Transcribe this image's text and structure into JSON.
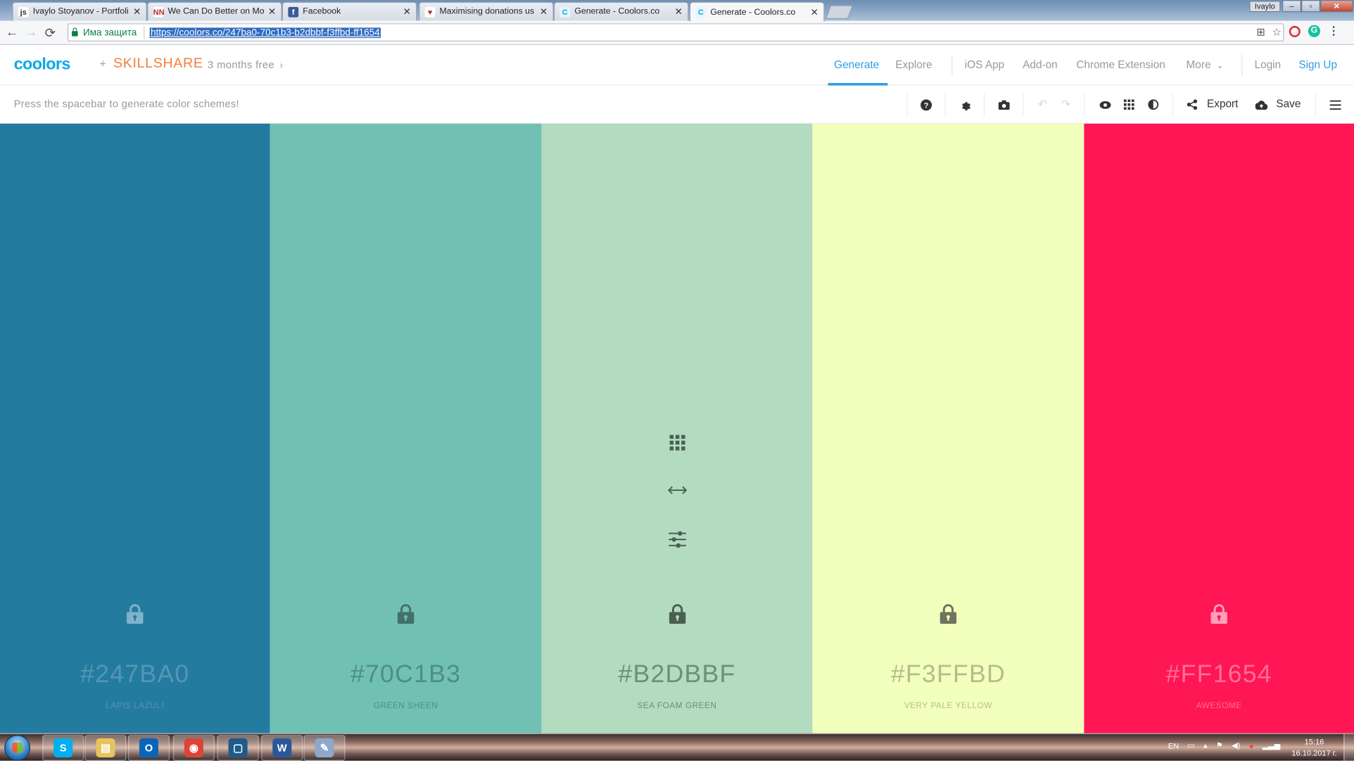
{
  "browser": {
    "tabs": [
      {
        "title": "Ivaylo Stoyanov - Portfoli",
        "favicon": "js-icon",
        "fav_text": "js",
        "fav_color": "#ffffff",
        "fav_text_color": "#333333"
      },
      {
        "title": "We Can Do Better on Mo",
        "favicon": "nn-icon",
        "fav_text": "NN",
        "fav_color": "#ffffff",
        "fav_text_color": "#c62828"
      },
      {
        "title": "Facebook",
        "favicon": "facebook-icon",
        "fav_text": "f",
        "fav_color": "#3b5998",
        "fav_text_color": "#ffffff"
      },
      {
        "title": "Maximising donations us",
        "favicon": "heart-icon",
        "fav_text": "♥",
        "fav_color": "#ffffff",
        "fav_text_color": "#c62828"
      },
      {
        "title": "Generate - Coolors.co",
        "favicon": "coolors-icon",
        "fav_text": "C",
        "fav_color": "#e6f6fd",
        "fav_text_color": "#0aa8e6"
      },
      {
        "title": "Generate - Coolors.co",
        "favicon": "coolors-icon",
        "fav_text": "C",
        "fav_color": "#e6f6fd",
        "fav_text_color": "#0aa8e6",
        "active": true
      }
    ],
    "profile": "Ivaylo",
    "secure_label": "Има защита",
    "url": "https://coolors.co/247ba0-70c1b3-b2dbbf-f3ffbd-ff1654"
  },
  "header": {
    "logo": "coolors",
    "plus": "+",
    "partner_skill": "SKILL",
    "partner_share": "SHARE",
    "promo": "3 months free",
    "nav": [
      "Generate",
      "Explore",
      "iOS App",
      "Add-on",
      "Chrome Extension",
      "More",
      "Login",
      "Sign Up"
    ]
  },
  "toolbar": {
    "hint": "Press the spacebar to generate color schemes!",
    "export_label": "Export",
    "save_label": "Save"
  },
  "palette": [
    {
      "hex": "#247BA0",
      "name": "LAPIS LAZULI",
      "color": "#247ba0",
      "text_color": "#5695b4",
      "lock_color": "#7fb3cc"
    },
    {
      "hex": "#70C1B3",
      "name": "GREEN SHEEN",
      "color": "#70c1b3",
      "text_color": "#4f8e84",
      "lock_color": "#44706a"
    },
    {
      "hex": "#B2DBBF",
      "name": "SEA FOAM GREEN",
      "color": "#b2dbbf",
      "text_color": "#6b8f78",
      "lock_color": "#4a5f52"
    },
    {
      "hex": "#F3FFBD",
      "name": "VERY PALE YELLOW",
      "color": "#f3ffbd",
      "text_color": "#b3bd8b",
      "lock_color": "#6f7460"
    },
    {
      "hex": "#FF1654",
      "name": "AWESOME",
      "color": "#ff1654",
      "text_color": "#ff6f93",
      "lock_color": "#ff9fb8"
    }
  ],
  "taskbar": {
    "apps": [
      {
        "icon": "skype-icon",
        "label": "S",
        "color": "#00aff0"
      },
      {
        "icon": "folder-icon",
        "label": "▤",
        "color": "#e7c35a"
      },
      {
        "icon": "outlook-icon",
        "label": "O",
        "color": "#0a64b8"
      },
      {
        "icon": "chrome-icon",
        "label": "◉",
        "color": "#db4437"
      },
      {
        "icon": "app-window-icon",
        "label": "▢",
        "color": "#1e5a8a"
      },
      {
        "icon": "word-icon",
        "label": "W",
        "color": "#2b579a"
      },
      {
        "icon": "paint-icon",
        "label": "✎",
        "color": "#8fa7c8"
      }
    ],
    "lang": "EN",
    "time": "15:16",
    "date": "16.10.2017 г."
  }
}
